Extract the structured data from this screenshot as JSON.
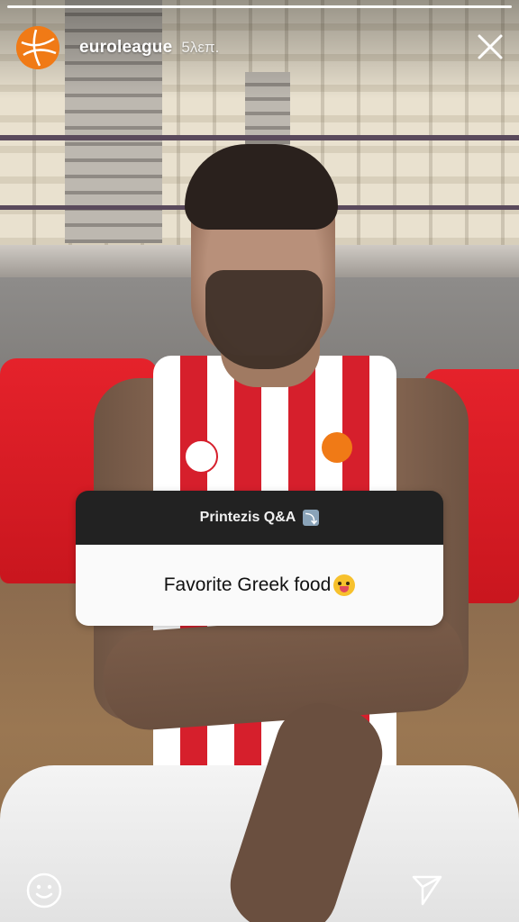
{
  "story": {
    "account": "euroleague",
    "time_ago": "5λεπ."
  },
  "question_sticker": {
    "title": "Printezis Q&A",
    "question": "Favorite Greek food"
  },
  "icons": {
    "avatar": "euroleague-logo-icon",
    "close": "close-icon",
    "reaction": "smiley-face-icon",
    "send": "send-paper-plane-icon"
  },
  "colors": {
    "brand_orange": "#f07a16",
    "sticker_header": "#222222",
    "jersey_red": "#d61f2c"
  }
}
